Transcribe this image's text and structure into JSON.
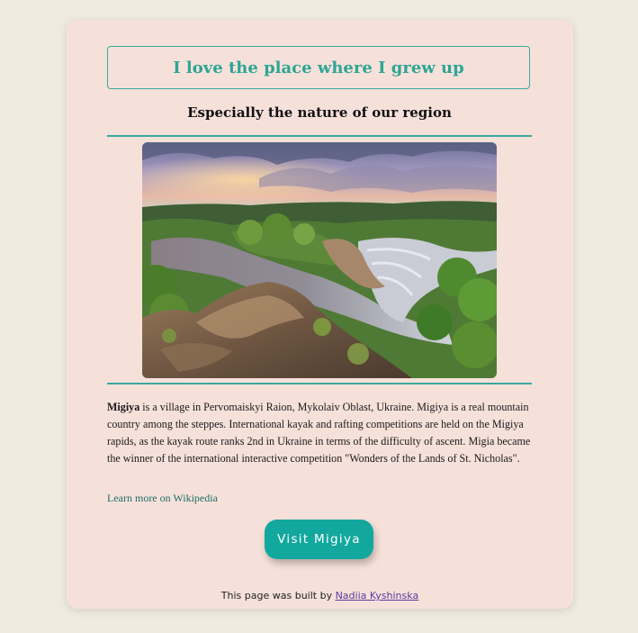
{
  "header": {
    "title": "I love the place where I grew up",
    "subtitle": "Especially the nature of our region"
  },
  "photo": {
    "alt": "Migiya canyon with rocks and river rapids"
  },
  "description": {
    "strong": "Migiya",
    "text": " is a village in Pervomaiskyi Raion, Mykolaiv Oblast, Ukraine. Migiya is a real mountain country among the steppes. International kayak and rafting competitions are held on the Migiya rapids, as the kayak route ranks 2nd in Ukraine in terms of the difficulty of ascent. Migia became the winner of the international interactive competition \"Wonders of the Lands of St. Nicholas\"."
  },
  "links": {
    "wiki": "Learn more on Wikipedia"
  },
  "actions": {
    "visit": "Visit Migiya"
  },
  "footer": {
    "text": "This page was built by ",
    "author": "Nadiia Kyshinska"
  },
  "colors": {
    "page_bg": "#f0ebe0",
    "card_bg": "#f6e1da",
    "accent": "#2ea594",
    "button": "#13a89e",
    "link": "#1f6d66",
    "author_link": "#5b3aa0"
  }
}
